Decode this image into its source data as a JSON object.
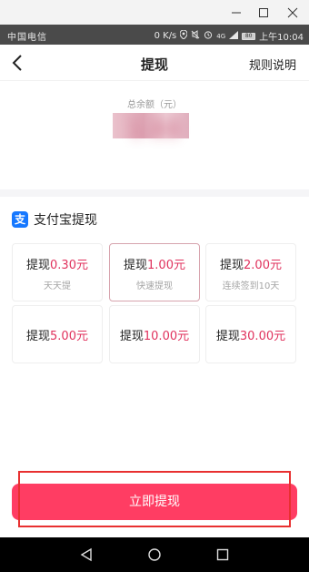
{
  "window": {
    "minimize_icon": "minimize-icon",
    "maximize_icon": "maximize-icon",
    "close_icon": "close-icon"
  },
  "status_bar": {
    "carrier": "中国电信",
    "speed": "0 K/s",
    "network": "4G",
    "battery": "80",
    "time": "上午10:04"
  },
  "header": {
    "back_icon": "chevron-left-icon",
    "title": "提现",
    "rules_label": "规则说明"
  },
  "balance": {
    "label": "总余额（元）",
    "amount": "1.88"
  },
  "withdraw": {
    "method_icon": "alipay-icon",
    "method_glyph": "支",
    "method_label": "支付宝提现",
    "accent_color": "#e0325d",
    "options": [
      {
        "prefix": "提现",
        "amount": "0.30元",
        "note": "天天提",
        "selected": false
      },
      {
        "prefix": "提现",
        "amount": "1.00元",
        "note": "快速提现",
        "selected": true
      },
      {
        "prefix": "提现",
        "amount": "2.00元",
        "note": "连续签到10天",
        "selected": false
      },
      {
        "prefix": "提现",
        "amount": "5.00元",
        "note": "",
        "selected": false
      },
      {
        "prefix": "提现",
        "amount": "10.00元",
        "note": "",
        "selected": false
      },
      {
        "prefix": "提现",
        "amount": "30.00元",
        "note": "",
        "selected": false
      }
    ]
  },
  "submit_label": "立即提现",
  "nav": {
    "back_icon": "nav-back-icon",
    "home_icon": "nav-home-icon",
    "recent_icon": "nav-recent-icon"
  }
}
